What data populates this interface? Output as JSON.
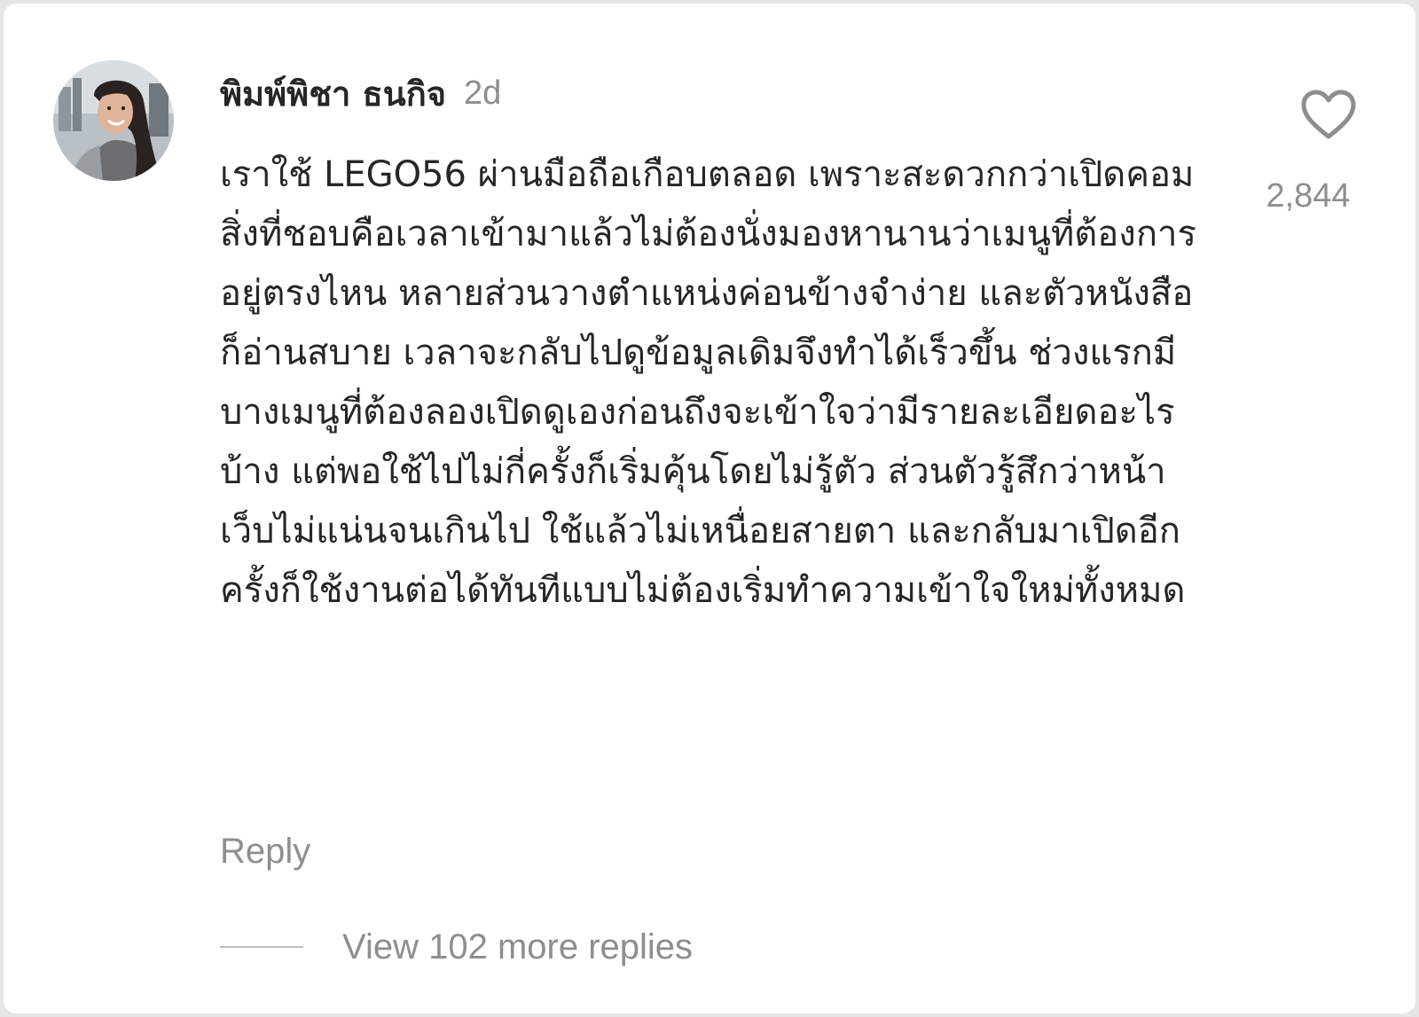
{
  "comment": {
    "username": "พิมพ์พิชา ธนกิจ",
    "timestamp": "2d",
    "text": "เราใช้ LEGO56 ผ่านมือถือเกือบตลอด เพราะสะดวกกว่าเปิดคอม สิ่งที่ชอบคือเวลาเข้ามาแล้วไม่ต้องนั่งมองหานานว่าเมนูที่ต้องการอยู่ตรงไหน หลายส่วนวางตำแหน่งค่อนข้างจำง่าย และตัวหนังสือก็อ่านสบาย เวลาจะกลับไปดูข้อมูลเดิมจึงทำได้เร็วขึ้น ช่วงแรกมีบางเมนูที่ต้องลองเปิดดูเองก่อนถึงจะเข้าใจว่ามีรายละเอียดอะไรบ้าง แต่พอใช้ไปไม่กี่ครั้งก็เริ่มคุ้นโดยไม่รู้ตัว ส่วนตัวรู้สึกว่าหน้าเว็บไม่แน่นจนเกินไป ใช้แล้วไม่เหนื่อยสายตา และกลับมาเปิดอีกครั้งก็ใช้งานต่อได้ทันทีแบบไม่ต้องเริ่มทำความเข้าใจใหม่ทั้งหมด",
    "like_count": "2,844",
    "reply_label": "Reply",
    "view_replies_label": "View 102 more replies"
  },
  "icons": {
    "like": "heart-outline-icon",
    "avatar": "user-avatar"
  },
  "colors": {
    "primary_text": "#262626",
    "secondary_text": "#8e8e8e",
    "background": "#ffffff",
    "divider": "#bdbdbd"
  }
}
